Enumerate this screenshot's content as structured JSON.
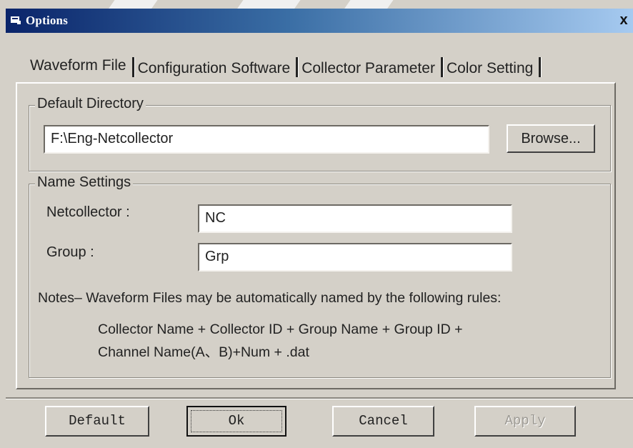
{
  "window": {
    "title": "Options",
    "close_label": "x"
  },
  "tabs": [
    {
      "label": "Waveform File",
      "active": true
    },
    {
      "label": "Configuration Software",
      "active": false
    },
    {
      "label": "Collector Parameter",
      "active": false
    },
    {
      "label": "Color Setting",
      "active": false
    }
  ],
  "default_directory": {
    "group_label": "Default Directory",
    "path_value": "F:\\Eng-Netcollector",
    "browse_label": "Browse..."
  },
  "name_settings": {
    "group_label": "Name Settings",
    "netcollector_label": "Netcollector :",
    "netcollector_value": "NC",
    "group_field_label": "Group :",
    "group_value": "Grp",
    "notes": "Notes– Waveform Files may be automatically named by the following rules:",
    "rule_line1": "Collector Name + Collector ID + Group Name + Group ID +",
    "rule_line2": "Channel Name(A、B)+Num + .dat"
  },
  "buttons": {
    "default_label": "Default",
    "ok_label": "Ok",
    "cancel_label": "Cancel",
    "apply_label": "Apply"
  }
}
